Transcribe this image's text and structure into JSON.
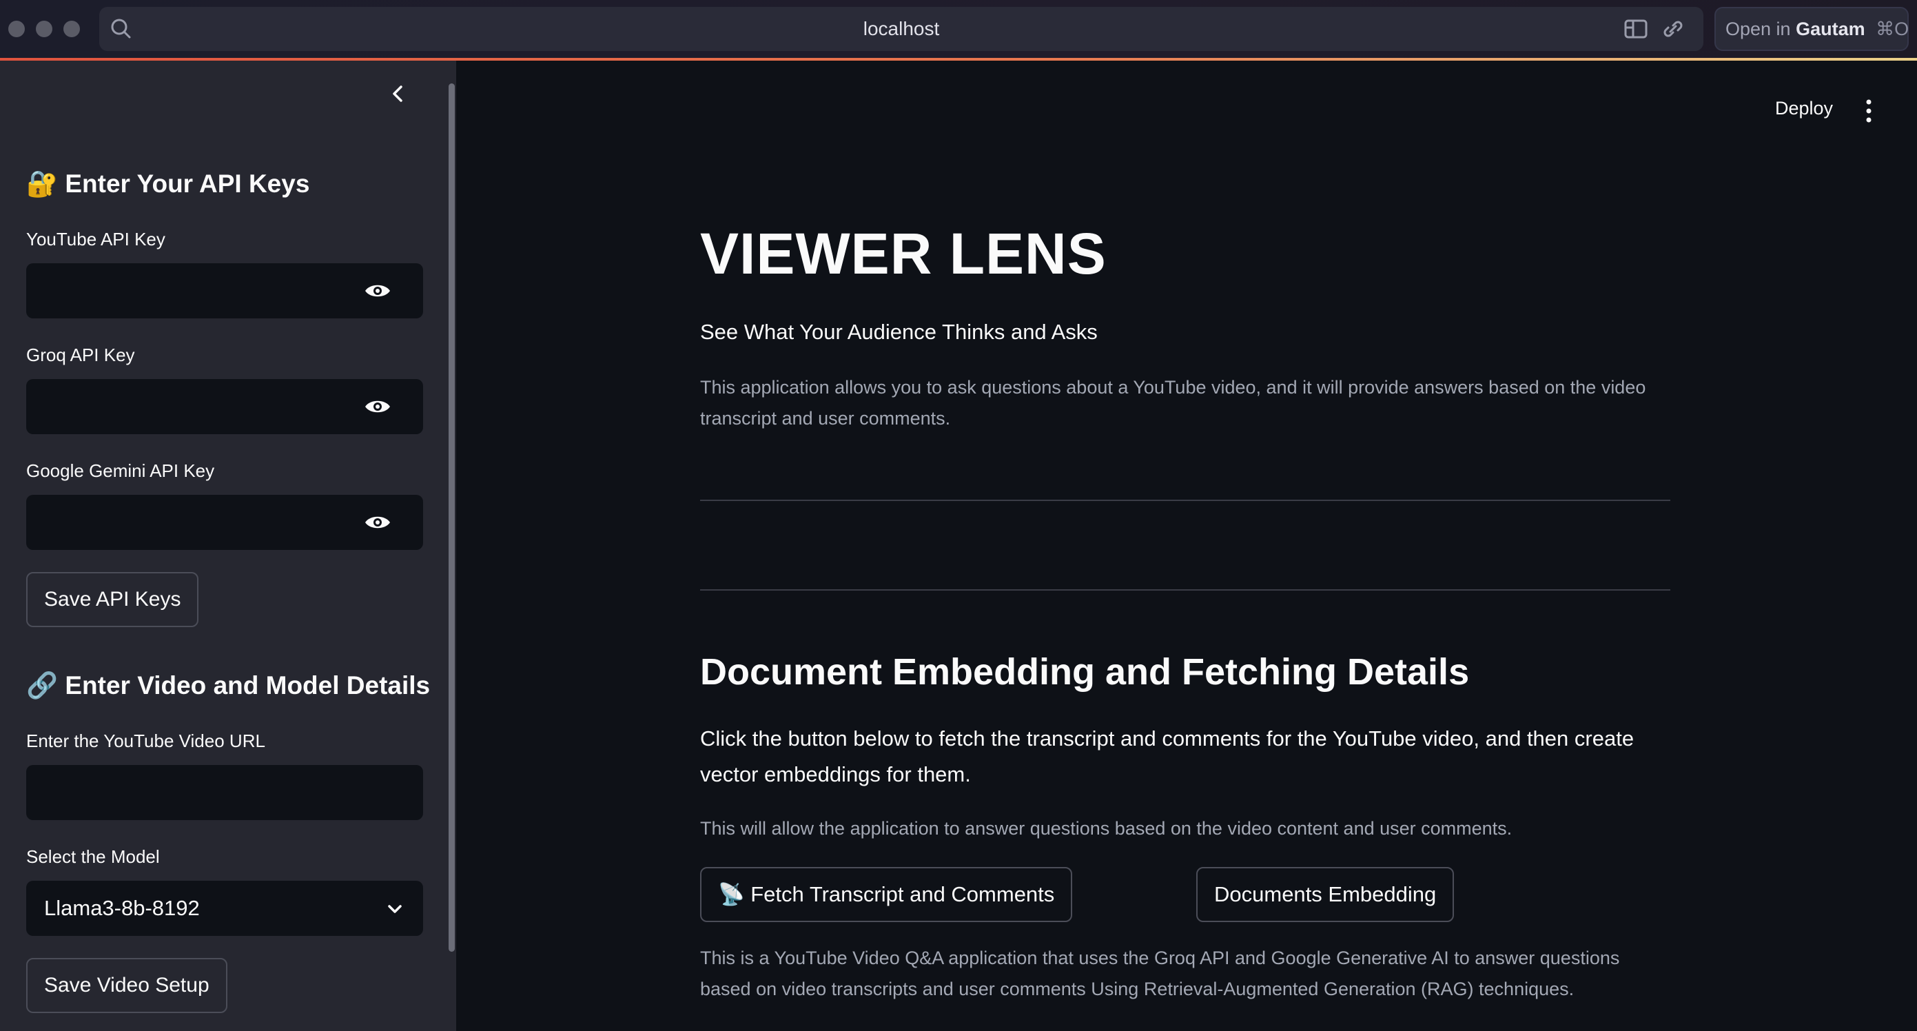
{
  "browser": {
    "url": "localhost",
    "open_in_prefix": "Open in",
    "open_in_app": "Gautam",
    "open_in_shortcut": "⌘O"
  },
  "sidebar": {
    "api_section_icon": "🔐",
    "api_section_title": "Enter Your API Keys",
    "youtube_key_label": "YouTube API Key",
    "youtube_key_value": "",
    "groq_key_label": "Groq API Key",
    "groq_key_value": "",
    "gemini_key_label": "Google Gemini API Key",
    "gemini_key_value": "",
    "save_keys_label": "Save API Keys",
    "video_section_icon": "🔗",
    "video_section_title": "Enter Video and Model Details",
    "url_label": "Enter the YouTube Video URL",
    "url_value": "",
    "model_label": "Select the Model",
    "model_selected": "Llama3-8b-8192",
    "save_video_label": "Save Video Setup"
  },
  "header": {
    "deploy_label": "Deploy"
  },
  "main": {
    "title": "VIEWER LENS",
    "subtitle": "See What Your Audience Thinks and Asks",
    "intro": "This application allows you to ask questions about a YouTube video, and it will provide answers based on the video transcript and user comments.",
    "section_title": "Document Embedding and Fetching Details",
    "section_body": "Click the button below to fetch the transcript and comments for the YouTube video, and then create vector embeddings for them.",
    "section_note": "This will allow the application to answer questions based on the video content and user comments.",
    "fetch_icon": "📡",
    "fetch_label": "Fetch Transcript and Comments",
    "embed_label": "Documents Embedding",
    "footer": "This is a YouTube Video Q&A application that uses the Groq API and Google Generative AI to answer questions based on video transcripts and user comments Using Retrieval-Augmented Generation (RAG) techniques."
  },
  "colors": {
    "background": "#0e1117",
    "sidebar": "#262730",
    "text": "#fafafa",
    "muted_text": "#a3a8b4",
    "accent_bar": "#e0533e"
  }
}
